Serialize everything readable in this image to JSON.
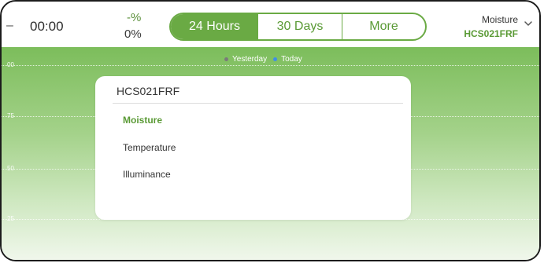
{
  "header": {
    "left_dash": "–",
    "time": "00:00",
    "percent_top": "-%",
    "percent_bottom": "0%",
    "tabs": [
      {
        "label": "24 Hours",
        "selected": true
      },
      {
        "label": "30 Days",
        "selected": false
      },
      {
        "label": "More",
        "selected": false
      }
    ],
    "sensor_type": "Moisture",
    "sensor_id": "HCS021FRF"
  },
  "chart": {
    "legend": [
      "Yesterday",
      "Today"
    ],
    "y_ticks": [
      "00",
      "75",
      "50",
      "25"
    ]
  },
  "popup": {
    "title": "HCS021FRF",
    "options": [
      {
        "label": "Moisture",
        "selected": true
      },
      {
        "label": "Temperature",
        "selected": false
      },
      {
        "label": "Illuminance",
        "selected": false
      }
    ]
  },
  "colors": {
    "accent": "#6aaa44",
    "accent_text": "#5a9a35",
    "legend_yesterday": "#7a7a7a",
    "legend_today": "#3f8ee8"
  }
}
